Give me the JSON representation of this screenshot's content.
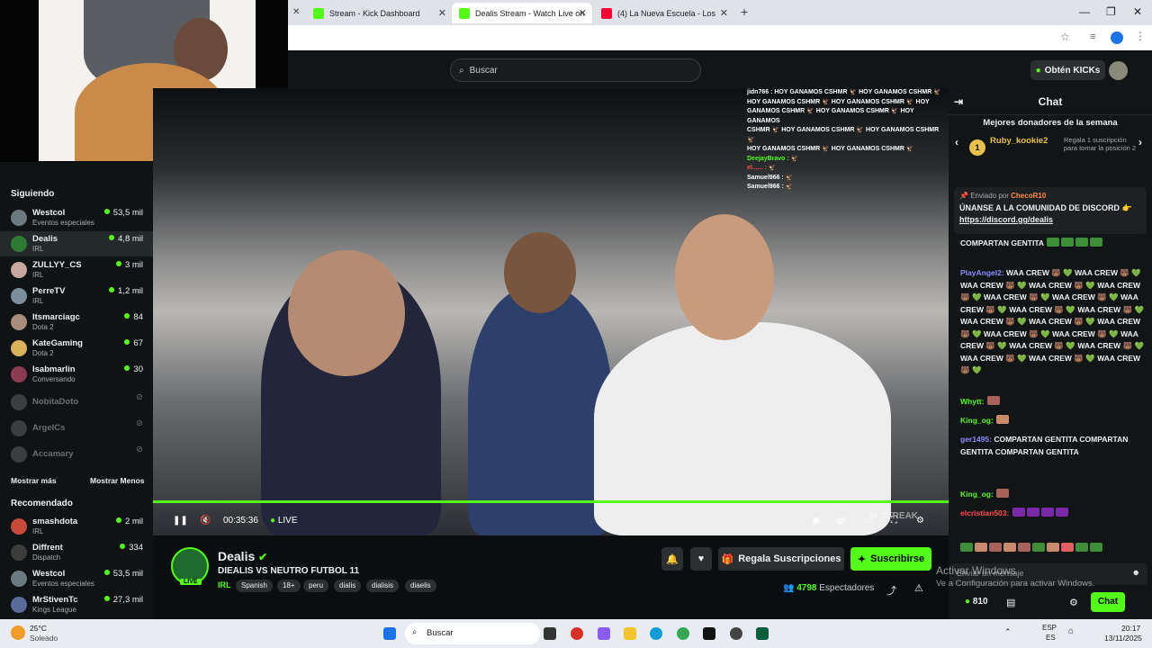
{
  "browser": {
    "tabs": [
      {
        "label": "Stream - Kick Dashboard",
        "active": false
      },
      {
        "label": "Dealis Stream - Watch Live on",
        "active": true
      },
      {
        "label": "(4) La Nueva Escuela - Los",
        "active": false
      }
    ],
    "new_tab": "+",
    "window_controls": [
      "—",
      "❐",
      "✕"
    ]
  },
  "header": {
    "search_placeholder": "Buscar",
    "kicks_button": "Obtén KICKs"
  },
  "sidebar": {
    "following_title": "Siguiendo",
    "following": [
      {
        "name": "Westcol",
        "sub": "Eventos especiales",
        "viewers": "53,5 mil",
        "color": "#6b7a7f"
      },
      {
        "name": "Dealis",
        "sub": "IRL",
        "viewers": "4,8 mil",
        "color": "#2c7a34"
      },
      {
        "name": "ZULLYY_CS",
        "sub": "IRL",
        "viewers": "3 mil",
        "color": "#c9a6a0"
      },
      {
        "name": "PerreTV",
        "sub": "IRL",
        "viewers": "1,2 mil",
        "color": "#7a8e9b"
      },
      {
        "name": "Itsmarciagc",
        "sub": "Dota 2",
        "viewers": "84",
        "color": "#a88c7c"
      },
      {
        "name": "KateGaming",
        "sub": "Dota 2",
        "viewers": "67",
        "color": "#d9b25a"
      },
      {
        "name": "Isabmarlin",
        "sub": "Conversando",
        "viewers": "30",
        "color": "#8c3b52"
      }
    ],
    "offline": [
      {
        "name": "NobitaDoto"
      },
      {
        "name": "ArgelCs"
      },
      {
        "name": "Accamary"
      }
    ],
    "show_more": "Mostrar más",
    "show_less": "Mostrar Menos",
    "recommended_title": "Recomendado",
    "recommended": [
      {
        "name": "smashdota",
        "sub": "IRL",
        "viewers": "2 mil",
        "color": "#c94a3a"
      },
      {
        "name": "Diffrent",
        "sub": "Dispatch",
        "viewers": "334",
        "color": "#3c3c3c"
      },
      {
        "name": "Westcol",
        "sub": "Eventos especiales",
        "viewers": "53,5 mil",
        "color": "#6b7a7f"
      },
      {
        "name": "MrStivenTc",
        "sub": "Kings League",
        "viewers": "27,3 mil",
        "color": "#5a6a9b"
      }
    ]
  },
  "video": {
    "overlay_chat": [
      "jidn766 : HOY GANAMOS CSHMR 🦅 HOY GANAMOS CSHMR 🦅",
      "HOY GANAMOS CSHMR 🦅 HOY GANAMOS CSHMR 🦅 HOY",
      "GANAMOS CSHMR 🦅 HOY GANAMOS CSHMR 🦅 HOY GANAMOS",
      "CSHMR 🦅 HOY GANAMOS CSHMR 🦅 HOY GANAMOS CSHMR 🦅",
      "HOY GANAMOS CSHMR 🦅 HOY GANAMOS CSHMR 🦅",
      "DeejayBravo : 🦅",
      "el...... : 🦅",
      "Samuel966 : 🦅",
      "Samuel966 : 🦅"
    ],
    "time": "00:35:36",
    "live": "LIVE",
    "progress": 1.0,
    "streak_overlay": "3x STREAK"
  },
  "stream": {
    "name": "Dealis",
    "title": "DIEALIS VS NEUTRO FUTBOL 11",
    "category": "IRL",
    "live_badge": "LIVE",
    "tags": [
      "Spanish",
      "18+",
      "peru",
      "dialis",
      "dialisis",
      "diaelis"
    ],
    "gift_button": "Regala Suscripciones",
    "subscribe_button": "Suscribirse",
    "viewers_count": "4798",
    "viewers_label": "Espectadores"
  },
  "chat": {
    "title": "Chat",
    "donors_title": "Mejores donadores de la semana",
    "top_donor": "Ruby_kookie2",
    "top_donor_count": "1",
    "donor_note": "Regala 1 suscripción para tomar la posición 2",
    "pinned_by_label": "Enviado por",
    "pinned_by": "ChecoR10",
    "pinned_text": "ÚNANSE A LA COMUNIDAD DE DISCORD 👉",
    "pinned_link": "https://discord.gg/dealis",
    "messages": [
      {
        "user": "",
        "text": "COMPARTAN GENTITA"
      },
      {
        "user": "PlayAngel2:",
        "text": "WAA CREW 🐻 💚 WAA CREW 🐻 💚 WAA CREW 🐻 💚 WAA CREW 🐻 💚 WAA CREW 🐻 💚 WAA CREW 🐻 💚 WAA CREW 🐻 💚 WAA CREW 🐻 💚 WAA CREW 🐻 💚 WAA CREW 🐻 💚 WAA CREW 🐻 💚 WAA CREW 🐻 💚 WAA CREW 🐻 💚 WAA CREW 🐻 💚 WAA CREW 🐻 💚 WAA CREW 🐻 💚 WAA CREW 🐻 💚 WAA CREW 🐻 💚 WAA CREW 🐻 💚 WAA CREW 🐻 💚 WAA CREW 🐻 💚"
      },
      {
        "user": "Whytt:",
        "text": ""
      },
      {
        "user": "King_og:",
        "text": ""
      },
      {
        "user": "ger1495:",
        "text": "COMPARTAN GENTITA COMPARTAN GENTITA COMPARTAN GENTITA"
      },
      {
        "user": "King_og:",
        "text": ""
      },
      {
        "user": "elcristian503:",
        "text": ""
      }
    ],
    "input_placeholder": "Enviar un mensaje",
    "kicks_count": "810",
    "send_button": "Chat"
  },
  "watermark": {
    "line1": "Activar Windows",
    "line2": "Ve a Configuración para activar Windows."
  },
  "taskbar": {
    "weather_temp": "25°C",
    "weather_desc": "Soleado",
    "search": "Buscar",
    "lang1": "ESP",
    "lang2": "ES",
    "time": "20:17",
    "date": "13/11/2025"
  }
}
